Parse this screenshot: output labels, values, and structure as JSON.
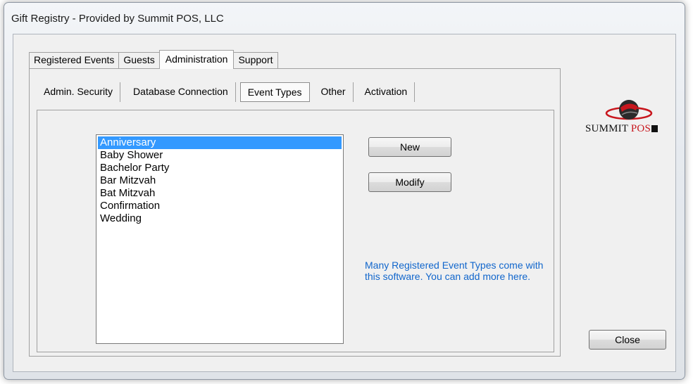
{
  "window": {
    "title": "Gift Registry - Provided by Summit POS, LLC"
  },
  "tabs": [
    {
      "label": "Registered Events",
      "active": false
    },
    {
      "label": "Guests",
      "active": false
    },
    {
      "label": "Administration",
      "active": true
    },
    {
      "label": "Support",
      "active": false
    }
  ],
  "subtabs": [
    {
      "label": "Admin. Security",
      "active": false
    },
    {
      "label": "Database Connection",
      "active": false
    },
    {
      "label": "Event Types",
      "active": true
    },
    {
      "label": "Other",
      "active": false
    },
    {
      "label": "Activation",
      "active": false
    }
  ],
  "event_types": {
    "items": [
      "Anniversary",
      "Baby Shower",
      "Bachelor Party",
      "Bar Mitzvah",
      "Bat Mitzvah",
      "Confirmation",
      "Wedding"
    ],
    "selected": "Anniversary"
  },
  "buttons": {
    "new_label": "New",
    "modify_label": "Modify",
    "close_label": "Close"
  },
  "info_text": "Many Registered Event Types come with this software.  You can add more here.",
  "logo": {
    "text_main": "SUMMIT",
    "text_accent": "POS"
  },
  "colors": {
    "selection": "#3399ff",
    "info_text": "#1166cc",
    "logo_accent": "#c8161d"
  }
}
